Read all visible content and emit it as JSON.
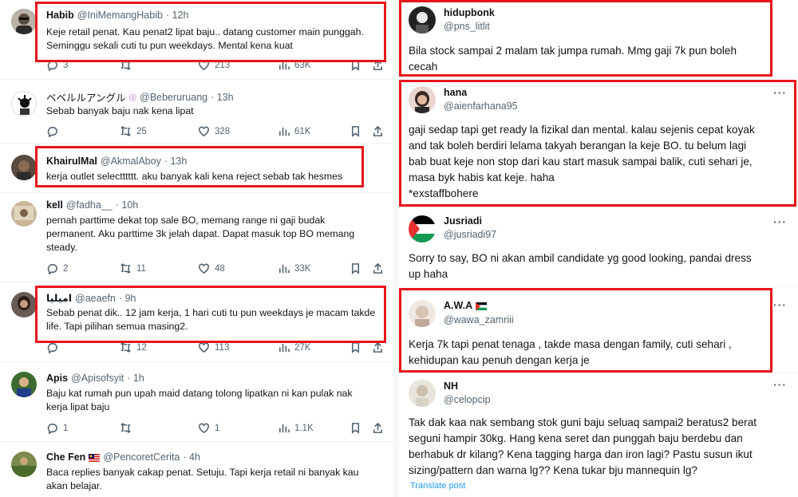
{
  "left": {
    "tweets": [
      {
        "name": "Habib",
        "handle": "@IniMemangHabib",
        "time": "· 12h",
        "text": "Keje retail penat. Kau penat2 lipat baju.. datang customer main punggah.\nSeminggu sekali cuti tu pun weekdays. Mental kena kuat",
        "replies": "3",
        "retweets": "",
        "likes": "213",
        "views": "63K"
      },
      {
        "name": "ベベルルアングル",
        "handle": "@Beberuruang",
        "time": "· 13h",
        "text": "Sebab banyak baju nak kena lipat",
        "replies": "",
        "retweets": "25",
        "likes": "328",
        "views": "61K"
      },
      {
        "name": "KhairulMal",
        "handle": "@AkmalAboy",
        "time": "· 13h",
        "text": "kerja outlet selectttttt. aku banyak kali kena reject sebab tak hesmes",
        "replies": "",
        "retweets": "",
        "likes": "",
        "views": ""
      },
      {
        "name": "kell",
        "handle": "@fadha__",
        "time": "· 10h",
        "text": "pernah parttime dekat top sale BO, memang range ni gaji budak\npermanent. Aku parttime 3k jelah dapat. Dapat masuk top BO memang\nsteady.",
        "replies": "2",
        "retweets": "11",
        "likes": "48",
        "views": "33K"
      },
      {
        "name": "اميليا",
        "handle": "@aeaefn",
        "time": "· 9h",
        "text": "Sebab penat dik.. 12 jam kerja, 1 hari cuti tu pun weekdays je macam takde\nlife. Tapi pilihan semua masing2.",
        "replies": "",
        "retweets": "12",
        "likes": "113",
        "views": "27K"
      },
      {
        "name": "Apis",
        "handle": "@Apisofsyit",
        "time": "· 1h",
        "text": "Baju kat rumah pun upah maid datang tolong lipatkan ni kan pulak nak\nkerja lipat baju",
        "replies": "1",
        "retweets": "",
        "likes": "1",
        "views": "1.1K"
      },
      {
        "name": "Che Fen",
        "handle": "@PencoretCerita",
        "time": "· 4h",
        "text": "Baca replies banyak cakap penat. Setuju. Tapi kerja retail ni banyak kau\nakan belajar.",
        "replies": "",
        "retweets": "",
        "likes": "",
        "views": ""
      }
    ]
  },
  "right": {
    "tweets": [
      {
        "name": "hidupbonk",
        "handle": "@pns_litlit",
        "text": "Bila stock sampai 2 malam tak jumpa rumah. Mmg gaji 7k pun boleh\ncecah"
      },
      {
        "name": "hana",
        "handle": "@aienfarhana95",
        "text": "gaji sedap tapi get ready la fizikal dan mental. kalau sejenis cepat koyak\nand tak boleh berdiri lelama takyah berangan la keje BO. tu belum lagi\nbab buat keje non stop dari kau start masuk sampai balik, cuti sehari je,\nmasa byk habis kat keje. haha\n *exstaffbohere"
      },
      {
        "name": "Jusriadi",
        "handle": "@jusriadi97",
        "text": "Sorry to say, BO ni akan ambil candidate yg good looking, pandai dress\nup haha"
      },
      {
        "name": "A.W.A",
        "handle": "@wawa_zamriii",
        "text": "Kerja 7k tapi penat tenaga , takde masa dengan family, cuti sehari ,\nkehidupan kau penuh dengan kerja je"
      },
      {
        "name": "NH",
        "handle": "@celopcip",
        "text": "Tak dak kaa nak sembang stok guni baju seluaq sampai2 beratus2 berat\nseguni hampir 30kg. Hang kena seret dan punggah baju berdebu dan\nberhabuk dr kilang? Kena tagging harga dan iron lagi? Pastu susun ikut\nsizing/pattern dan warna lg?? Kena tukar bju mannequin lg?",
        "translate": "Translate post"
      }
    ],
    "more_label": "···"
  },
  "colors": {
    "highlight": "#e8141c",
    "muted": "#536471",
    "link": "#1d9bf0"
  }
}
